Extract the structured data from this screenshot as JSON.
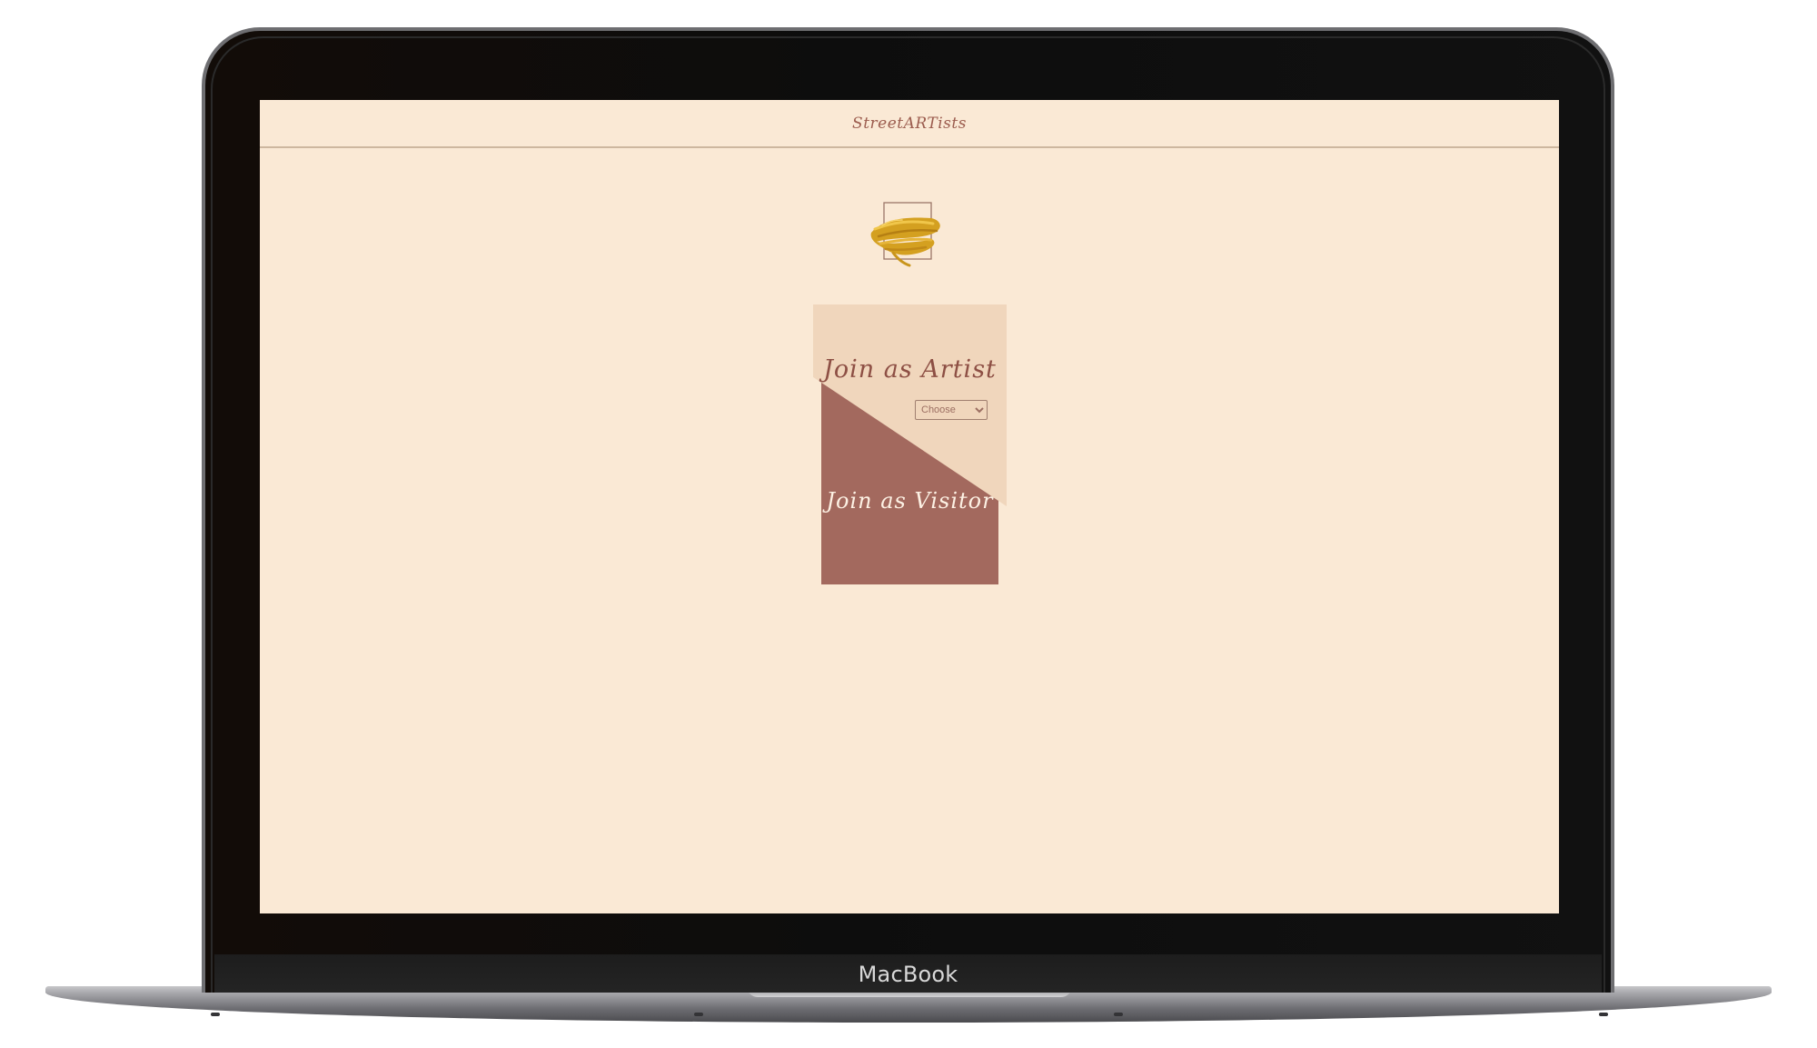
{
  "device": {
    "brand_label": "MacBook"
  },
  "header": {
    "site_title": "StreetARTists"
  },
  "logo": {
    "icon": "gold-paint-brush-stroke-icon",
    "accent_color": "#d9a521"
  },
  "join": {
    "artist_label": "Join as Artist",
    "artist_select": {
      "selected": "Choose",
      "options": [
        "Choose"
      ]
    },
    "visitor_label": "Join as Visitor"
  },
  "colors": {
    "page_background": "#fae9d5",
    "artist_panel": "#f0d6bc",
    "visitor_panel": "#a3695e",
    "title_text": "#9c5d4f"
  }
}
